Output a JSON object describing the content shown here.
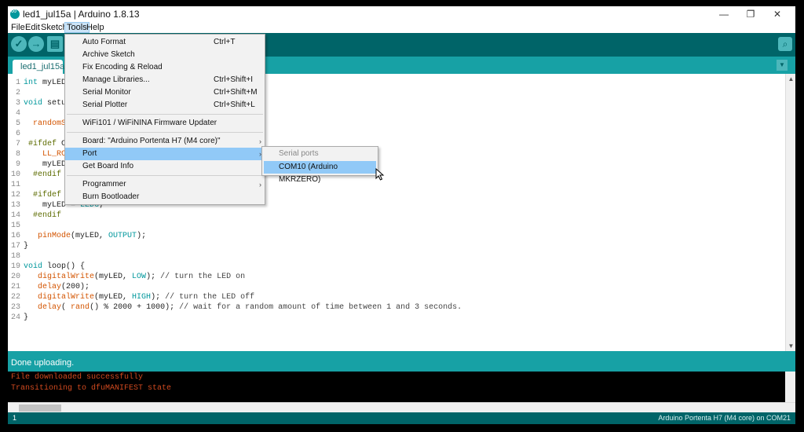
{
  "window": {
    "title": "led1_jul15a | Arduino 1.8.13",
    "controls": {
      "minimize": "—",
      "maximize": "❐",
      "close": "✕"
    }
  },
  "menubar": [
    "File",
    "Edit",
    "Sketch",
    "Tools",
    "Help"
  ],
  "toolbar": {
    "verify_icon": "✓",
    "upload_icon": "→",
    "new_icon": "▤",
    "serial_monitor_icon": "⌕"
  },
  "tab": {
    "name": "led1_jul15a",
    "menu_icon": "▼"
  },
  "code": [
    "int myLED;",
    "",
    "void setup() {",
    "",
    "  randomSeed(analogRead(0));",
    "",
    " #ifdef CORE_CM7",
    "    LL_RCC_ForceCM4Boot();",
    "    myLED = LEDR;",
    "  #endif",
    "",
    "  #ifdef CORE_CM4",
    "    myLED = LEDG;",
    "  #endif",
    "",
    "   pinMode(myLED, OUTPUT);",
    "}",
    "",
    "void loop() {",
    "   digitalWrite(myLED, LOW); // turn the LED on",
    "   delay(200);",
    "   digitalWrite(myLED, HIGH); // turn the LED off",
    "   delay( rand() % 2000 + 1000); // wait for a random amount of time between 1 and 3 seconds.",
    "}"
  ],
  "line_numbers": [
    "1",
    "2",
    "3",
    "4",
    "5",
    "6",
    "7",
    "8",
    "9",
    "10",
    "11",
    "12",
    "13",
    "14",
    "15",
    "16",
    "17",
    "18",
    "19",
    "20",
    "21",
    "22",
    "23",
    "24"
  ],
  "status": {
    "message": "Done uploading."
  },
  "console": [
    "File downloaded successfully",
    "Transitioning to dfuMANIFEST state"
  ],
  "footer": {
    "line": "1",
    "board": "Arduino Portenta H7 (M4 core) on COM21"
  },
  "tools_menu": {
    "groups": [
      [
        {
          "label": "Auto Format",
          "shortcut": "Ctrl+T"
        },
        {
          "label": "Archive Sketch",
          "shortcut": ""
        },
        {
          "label": "Fix Encoding & Reload",
          "shortcut": ""
        },
        {
          "label": "Manage Libraries...",
          "shortcut": "Ctrl+Shift+I"
        },
        {
          "label": "Serial Monitor",
          "shortcut": "Ctrl+Shift+M"
        },
        {
          "label": "Serial Plotter",
          "shortcut": "Ctrl+Shift+L"
        }
      ],
      [
        {
          "label": "WiFi101 / WiFiNINA Firmware Updater",
          "shortcut": ""
        }
      ],
      [
        {
          "label": "Board: \"Arduino Portenta H7 (M4 core)\"",
          "shortcut": "",
          "submenu": true
        },
        {
          "label": "Port",
          "shortcut": "",
          "submenu": true,
          "highlighted": true
        },
        {
          "label": "Get Board Info",
          "shortcut": ""
        }
      ],
      [
        {
          "label": "Programmer",
          "shortcut": "",
          "submenu": true
        },
        {
          "label": "Burn Bootloader",
          "shortcut": ""
        }
      ]
    ],
    "arrow": "›"
  },
  "port_submenu": {
    "header": "Serial ports",
    "items": [
      "COM10 (Arduino MKRZERO)"
    ]
  }
}
